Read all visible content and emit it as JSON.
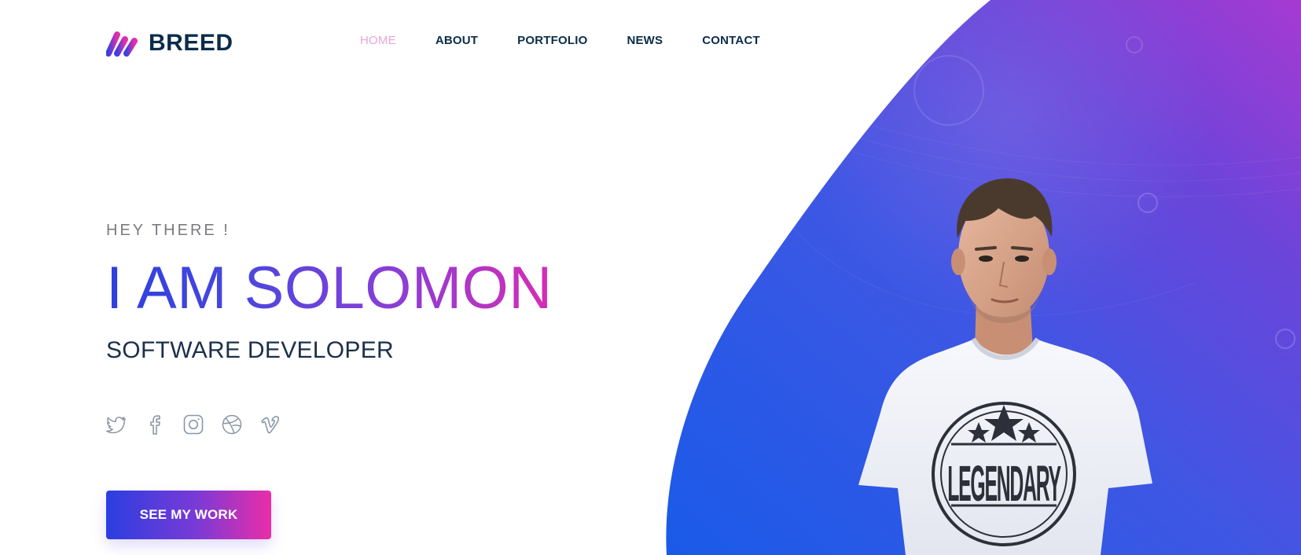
{
  "brand": {
    "name": "BREED"
  },
  "nav": {
    "items": [
      {
        "label": "HOME",
        "active": true
      },
      {
        "label": "ABOUT",
        "active": false
      },
      {
        "label": "PORTFOLIO",
        "active": false
      },
      {
        "label": "NEWS",
        "active": false
      },
      {
        "label": "CONTACT",
        "active": false
      }
    ]
  },
  "hero": {
    "greeting": "HEY THERE !",
    "headline": "I AM SOLOMON",
    "role": "SOFTWARE DEVELOPER",
    "cta_label": "SEE MY WORK"
  },
  "socials": [
    "twitter-icon",
    "facebook-icon",
    "instagram-icon",
    "dribbble-icon",
    "vimeo-icon"
  ],
  "photo": {
    "shirt_text": "LEGENDARY"
  },
  "colors": {
    "accent_blue": "#2c3fe0",
    "accent_pink": "#e92ea8",
    "nav_active": "#e6a6d8",
    "dark_text": "#0b2c4a"
  }
}
